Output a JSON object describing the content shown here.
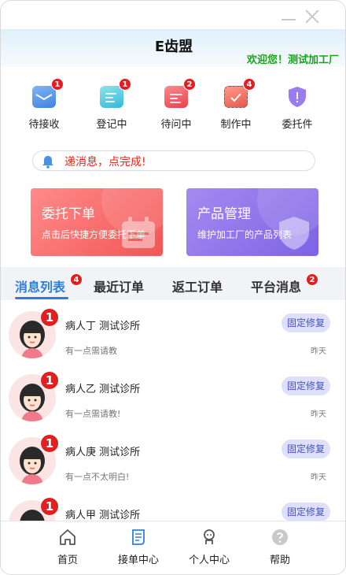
{
  "app": {
    "title": "E齿盟",
    "welcome": "欢迎您！测试加工厂"
  },
  "quick_actions": [
    {
      "label": "待接收",
      "badge": "1",
      "icon": "inbox-icon",
      "color": "#4b8fe6"
    },
    {
      "label": "登记中",
      "badge": "1",
      "icon": "register-icon",
      "color": "#3fc0d8"
    },
    {
      "label": "待问中",
      "badge": "2",
      "icon": "inquiry-icon",
      "color": "#ef4b52"
    },
    {
      "label": "制作中",
      "badge": "4",
      "icon": "production-icon",
      "color": "#ef6a5e"
    },
    {
      "label": "委托件",
      "badge": "",
      "icon": "shield-icon",
      "color": "#8b6be8"
    }
  ],
  "notice": {
    "text": "递消息，点完成!"
  },
  "cards": [
    {
      "title": "委托下单",
      "subtitle": "点击后快捷方便委托下单",
      "color": "#f25656"
    },
    {
      "title": "产品管理",
      "subtitle": "维护加工厂的产品列表",
      "color": "#7d63e6"
    }
  ],
  "tabs": [
    {
      "label": "消息列表",
      "badge": "4",
      "active": true
    },
    {
      "label": "最近订单",
      "badge": "",
      "active": false
    },
    {
      "label": "返工订单",
      "badge": "",
      "active": false
    },
    {
      "label": "平台消息",
      "badge": "2",
      "active": false
    }
  ],
  "messages": [
    {
      "name": "病人丁 测试诊所",
      "text": "有一点需请教",
      "tag": "固定修复",
      "time": "昨天",
      "badge": "1"
    },
    {
      "name": "病人乙 测试诊所",
      "text": "有一点需请教!",
      "tag": "固定修复",
      "time": "昨天",
      "badge": "1"
    },
    {
      "name": "病人庚 测试诊所",
      "text": "有一点不太明白!",
      "tag": "固定修复",
      "time": "昨天",
      "badge": "1"
    },
    {
      "name": "病人甲 测试诊所",
      "text": "",
      "tag": "固定修复",
      "time": "",
      "badge": "1"
    }
  ],
  "bottom_nav": [
    {
      "label": "首页",
      "icon": "home-icon",
      "active": false
    },
    {
      "label": "接单中心",
      "icon": "order-center-icon",
      "active": true
    },
    {
      "label": "个人中心",
      "icon": "profile-icon",
      "active": false
    },
    {
      "label": "帮助",
      "icon": "help-icon",
      "active": false
    }
  ],
  "colors": {
    "accent": "#2e7fd8",
    "badge": "#e02020",
    "welcome": "#1aa41a",
    "notice": "#e0281e",
    "tag_bg": "#dde0f8",
    "tag_text": "#4a4fc8"
  }
}
